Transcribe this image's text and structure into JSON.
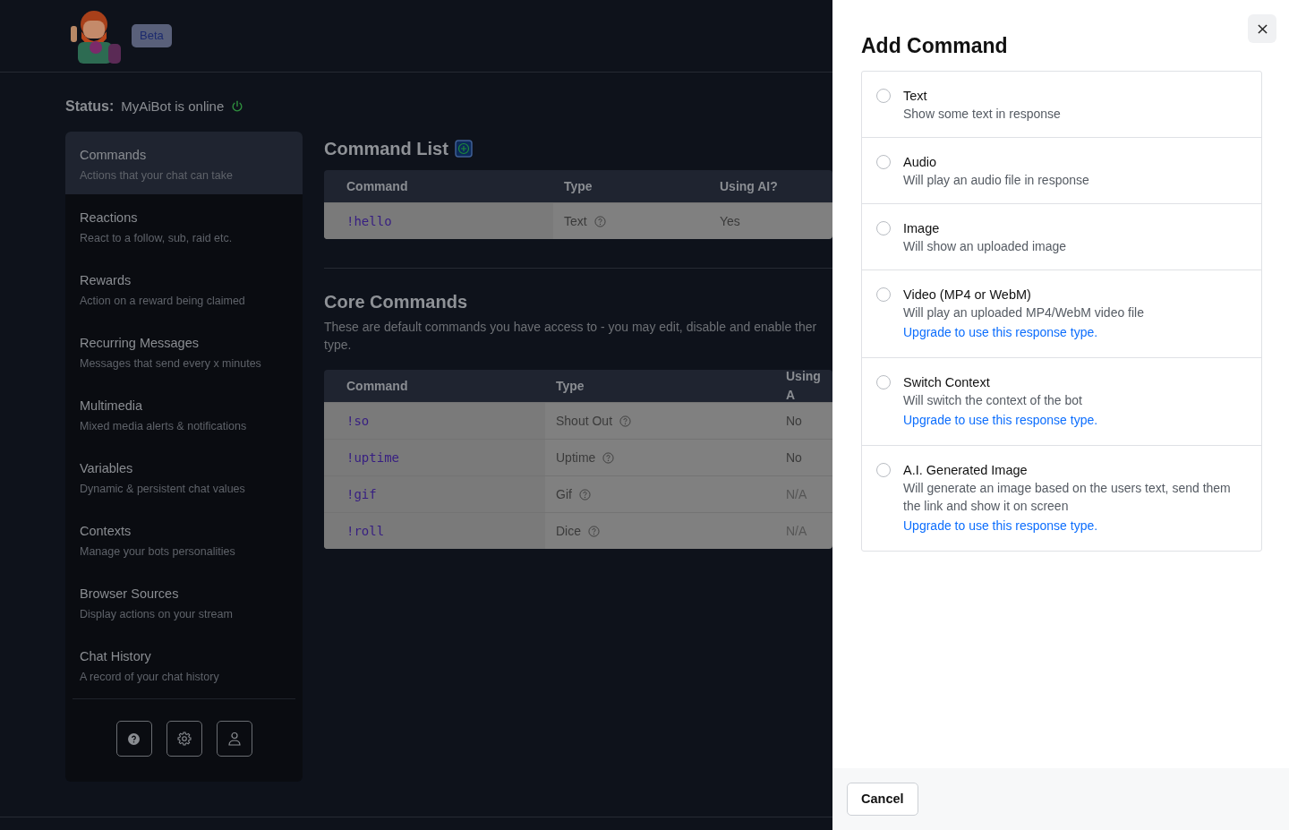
{
  "header": {
    "badge": "Beta"
  },
  "status": {
    "label": "Status:",
    "text": "MyAiBot is online",
    "online": true
  },
  "sidebar": {
    "items": [
      {
        "title": "Commands",
        "subtitle": "Actions that your chat can take",
        "selected": true
      },
      {
        "title": "Reactions",
        "subtitle": "React to a follow, sub, raid etc.",
        "selected": false
      },
      {
        "title": "Rewards",
        "subtitle": "Action on a reward being claimed",
        "selected": false
      },
      {
        "title": "Recurring Messages",
        "subtitle": "Messages that send every x minutes",
        "selected": false
      },
      {
        "title": "Multimedia",
        "subtitle": "Mixed media alerts & notifications",
        "selected": false
      },
      {
        "title": "Variables",
        "subtitle": "Dynamic & persistent chat values",
        "selected": false
      },
      {
        "title": "Contexts",
        "subtitle": "Manage your bots personalities",
        "selected": false
      },
      {
        "title": "Browser Sources",
        "subtitle": "Display actions on your stream",
        "selected": false
      },
      {
        "title": "Chat History",
        "subtitle": "A record of your chat history",
        "selected": false
      }
    ]
  },
  "command_list": {
    "title": "Command List",
    "columns": [
      "Command",
      "Type",
      "Using AI?"
    ],
    "rows": [
      {
        "command": "!hello",
        "type": "Text",
        "ai": "Yes",
        "dimmed": false
      }
    ]
  },
  "core_commands": {
    "title": "Core Commands",
    "description": [
      "These are default commands you have access to - you may edit, disable and enable ther",
      "type."
    ],
    "columns": [
      "Command",
      "Type",
      "Using A"
    ],
    "rows": [
      {
        "command": "!so",
        "type": "Shout Out",
        "ai": "No",
        "dimmed": false
      },
      {
        "command": "!uptime",
        "type": "Uptime",
        "ai": "No",
        "dimmed": false
      },
      {
        "command": "!gif",
        "type": "Gif",
        "ai": "N/A",
        "dimmed": true
      },
      {
        "command": "!roll",
        "type": "Dice",
        "ai": "N/A",
        "dimmed": true
      }
    ]
  },
  "panel": {
    "title": "Add Command",
    "options": [
      {
        "title": "Text",
        "description": "Show some text in response",
        "selected": false
      },
      {
        "title": "Audio",
        "description": "Will play an audio file in response",
        "selected": false
      },
      {
        "title": "Image",
        "description": "Will show an uploaded image",
        "selected": false
      },
      {
        "title": "Video (MP4 or WebM)",
        "description": "Will play an uploaded MP4/WebM video file",
        "upgrade": "Upgrade to use this response type.",
        "selected": false
      },
      {
        "title": "Switch Context",
        "description": "Will switch the context of the bot",
        "upgrade": "Upgrade to use this response type.",
        "selected": false
      },
      {
        "title": "A.I. Generated Image",
        "description": "Will generate an image based on the users text, send them the link and show it on screen",
        "upgrade": "Upgrade to use this response type.",
        "selected": false
      }
    ],
    "cancel": "Cancel"
  }
}
